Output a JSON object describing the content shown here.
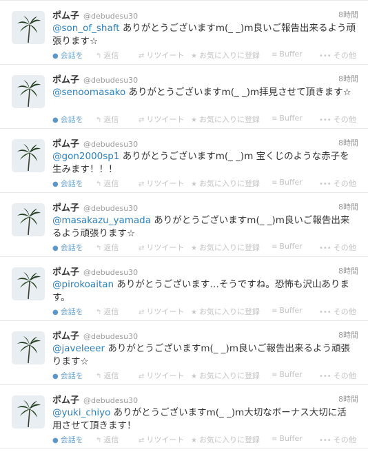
{
  "colors": {
    "mention": "#2a7fbe",
    "action_text": "#c2c2c2",
    "expand_text": "#6aa3d3",
    "meta_text": "#999999"
  },
  "actions": {
    "expand": "会話を",
    "reply": "返信",
    "retweet": "リツイート",
    "favorite": "お気に入りに登録",
    "buffer": "Buffer",
    "more": "その他",
    "icons": {
      "expand": "speech-bubble-icon",
      "reply": "reply-arrow-icon",
      "retweet": "retweet-icon",
      "favorite": "star-icon",
      "buffer": "buffer-stack-icon",
      "more": "ellipsis-icon"
    }
  },
  "tweets": [
    {
      "name": "ポム子",
      "handle": "@debudesu30",
      "time": "8時間",
      "mention": "@son_of_shaft",
      "text": " ありがとうございますm(_ _)m良いご報告出来るよう頑張ります☆"
    },
    {
      "name": "ポム子",
      "handle": "@debudesu30",
      "time": "8時間",
      "mention": "@senoomasako",
      "text": " ありがとうございますm(_ _)m拝見させて頂きます☆"
    },
    {
      "name": "ポム子",
      "handle": "@debudesu30",
      "time": "8時間",
      "mention": "@gon2000sp1",
      "text": " ありがとうございますm(_ _)m 宝くじのような赤子を生みます！！！"
    },
    {
      "name": "ポム子",
      "handle": "@debudesu30",
      "time": "8時間",
      "mention": "@masakazu_yamada",
      "text": " ありがとうございますm(_ _)m良いご報告出来るよう頑張ります☆"
    },
    {
      "name": "ポム子",
      "handle": "@debudesu30",
      "time": "8時間",
      "mention": "@pirokoaitan",
      "text": " ありがとうございます…そうですね。恐怖も沢山あります。"
    },
    {
      "name": "ポム子",
      "handle": "@debudesu30",
      "time": "8時間",
      "mention": "@javeleeer",
      "text": " ありがとうございますm(_ _)m良いご報告出来るよう頑張ります☆"
    },
    {
      "name": "ポム子",
      "handle": "@debudesu30",
      "time": "8時間",
      "mention": "@yuki_chiyo",
      "text": " ありがとうございますm(_ _)m大切なボーナス大切に活用させて頂きます！"
    }
  ]
}
